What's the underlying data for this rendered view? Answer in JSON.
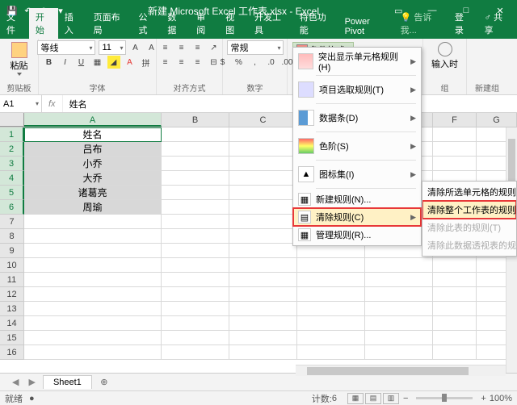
{
  "titlebar": {
    "title": "新建 Microsoft Excel 工作表.xlsx - Excel"
  },
  "tabs": {
    "items": [
      "文件",
      "开始",
      "插入",
      "页面布局",
      "公式",
      "数据",
      "审阅",
      "视图",
      "开发工具",
      "特色功能",
      "Power Pivot",
      "告诉我..."
    ],
    "active": 1,
    "login": "登录",
    "share": "共享"
  },
  "ribbon": {
    "clipboard": {
      "paste": "粘贴",
      "group_label": "剪贴板"
    },
    "font": {
      "name": "等线",
      "size": "11",
      "group_label": "字体"
    },
    "alignment": {
      "group_label": "对齐方式"
    },
    "number": {
      "format": "常规",
      "group_label": "数字"
    },
    "cf_button": "条件格式",
    "editing": {
      "insert_time": "输入时\n",
      "group": "组",
      "newgroup": "新建组"
    }
  },
  "cf_menu": {
    "highlight": "突出显示单元格规则(H)",
    "toprules": "项目选取规则(T)",
    "databars": "数据条(D)",
    "colorscales": "色阶(S)",
    "iconsets": "图标集(I)",
    "newrule": "新建规则(N)...",
    "clearrules": "清除规则(C)",
    "managerules": "管理规则(R)..."
  },
  "clear_submenu": {
    "selected": "清除所选单元格的规则(S)",
    "sheet": "清除整个工作表的规则(E)",
    "table": "清除此表的规则(T)",
    "pivot": "清除此数据透视表的规则(P)"
  },
  "formula_bar": {
    "namebox": "A1",
    "value": "姓名"
  },
  "columns": [
    "A",
    "B",
    "C",
    "D",
    "E",
    "F",
    "G"
  ],
  "data": {
    "A1": "姓名",
    "A2": "吕布",
    "A3": "小乔",
    "A4": "大乔",
    "A5": "诸葛亮",
    "A6": "周瑜"
  },
  "sheet_tab": "Sheet1",
  "status": {
    "ready": "就绪",
    "calc": "",
    "count_label": "计数:",
    "count": "6",
    "zoom": "100%"
  },
  "icons": {
    "save": "💾",
    "undo": "↶",
    "redo": "↷",
    "min": "—",
    "max": "□",
    "close": "✕",
    "rib_opts": "▾",
    "plus": "⊕",
    "fx": "fx",
    "rec": "●",
    "left": "◀",
    "right": "▶"
  }
}
